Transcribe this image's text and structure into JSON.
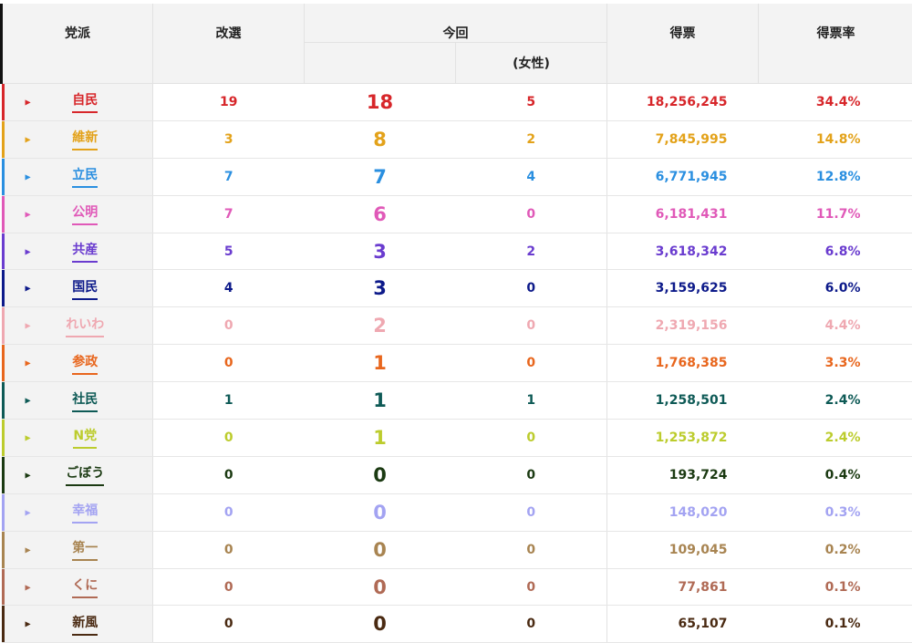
{
  "headers": {
    "party": "党派",
    "kaisen": "改選",
    "konkai": "今回",
    "josei": "(女性)",
    "tokuhyo": "得票",
    "ritsu": "得票率"
  },
  "rows": [
    {
      "party": "自民",
      "kaisen": "19",
      "konkai": "18",
      "josei": "5",
      "tokuhyo": "18,256,245",
      "ritsu": "34.4%",
      "color": "#d7262a"
    },
    {
      "party": "維新",
      "kaisen": "3",
      "konkai": "8",
      "josei": "2",
      "tokuhyo": "7,845,995",
      "ritsu": "14.8%",
      "color": "#e3a21a"
    },
    {
      "party": "立民",
      "kaisen": "7",
      "konkai": "7",
      "josei": "4",
      "tokuhyo": "6,771,945",
      "ritsu": "12.8%",
      "color": "#2a8fe0"
    },
    {
      "party": "公明",
      "kaisen": "7",
      "konkai": "6",
      "josei": "0",
      "tokuhyo": "6,181,431",
      "ritsu": "11.7%",
      "color": "#e059b8"
    },
    {
      "party": "共産",
      "kaisen": "5",
      "konkai": "3",
      "josei": "2",
      "tokuhyo": "3,618,342",
      "ritsu": "6.8%",
      "color": "#6a3ccf"
    },
    {
      "party": "国民",
      "kaisen": "4",
      "konkai": "3",
      "josei": "0",
      "tokuhyo": "3,159,625",
      "ritsu": "6.0%",
      "color": "#0d1a8a"
    },
    {
      "party": "れいわ",
      "kaisen": "0",
      "konkai": "2",
      "josei": "0",
      "tokuhyo": "2,319,156",
      "ritsu": "4.4%",
      "color": "#efa8b1"
    },
    {
      "party": "参政",
      "kaisen": "0",
      "konkai": "1",
      "josei": "0",
      "tokuhyo": "1,768,385",
      "ritsu": "3.3%",
      "color": "#e8661d"
    },
    {
      "party": "社民",
      "kaisen": "1",
      "konkai": "1",
      "josei": "1",
      "tokuhyo": "1,258,501",
      "ritsu": "2.4%",
      "color": "#0e5a56"
    },
    {
      "party": "N党",
      "kaisen": "0",
      "konkai": "1",
      "josei": "0",
      "tokuhyo": "1,253,872",
      "ritsu": "2.4%",
      "color": "#bccc2d"
    },
    {
      "party": "ごぼう",
      "kaisen": "0",
      "konkai": "0",
      "josei": "0",
      "tokuhyo": "193,724",
      "ritsu": "0.4%",
      "color": "#1b3a12"
    },
    {
      "party": "幸福",
      "kaisen": "0",
      "konkai": "0",
      "josei": "0",
      "tokuhyo": "148,020",
      "ritsu": "0.3%",
      "color": "#a3a3f2"
    },
    {
      "party": "第一",
      "kaisen": "0",
      "konkai": "0",
      "josei": "0",
      "tokuhyo": "109,045",
      "ritsu": "0.2%",
      "color": "#a88451"
    },
    {
      "party": "くに",
      "kaisen": "0",
      "konkai": "0",
      "josei": "0",
      "tokuhyo": "77,861",
      "ritsu": "0.1%",
      "color": "#b06a55"
    },
    {
      "party": "新風",
      "kaisen": "0",
      "konkai": "0",
      "josei": "0",
      "tokuhyo": "65,107",
      "ritsu": "0.1%",
      "color": "#4a2a12"
    }
  ]
}
